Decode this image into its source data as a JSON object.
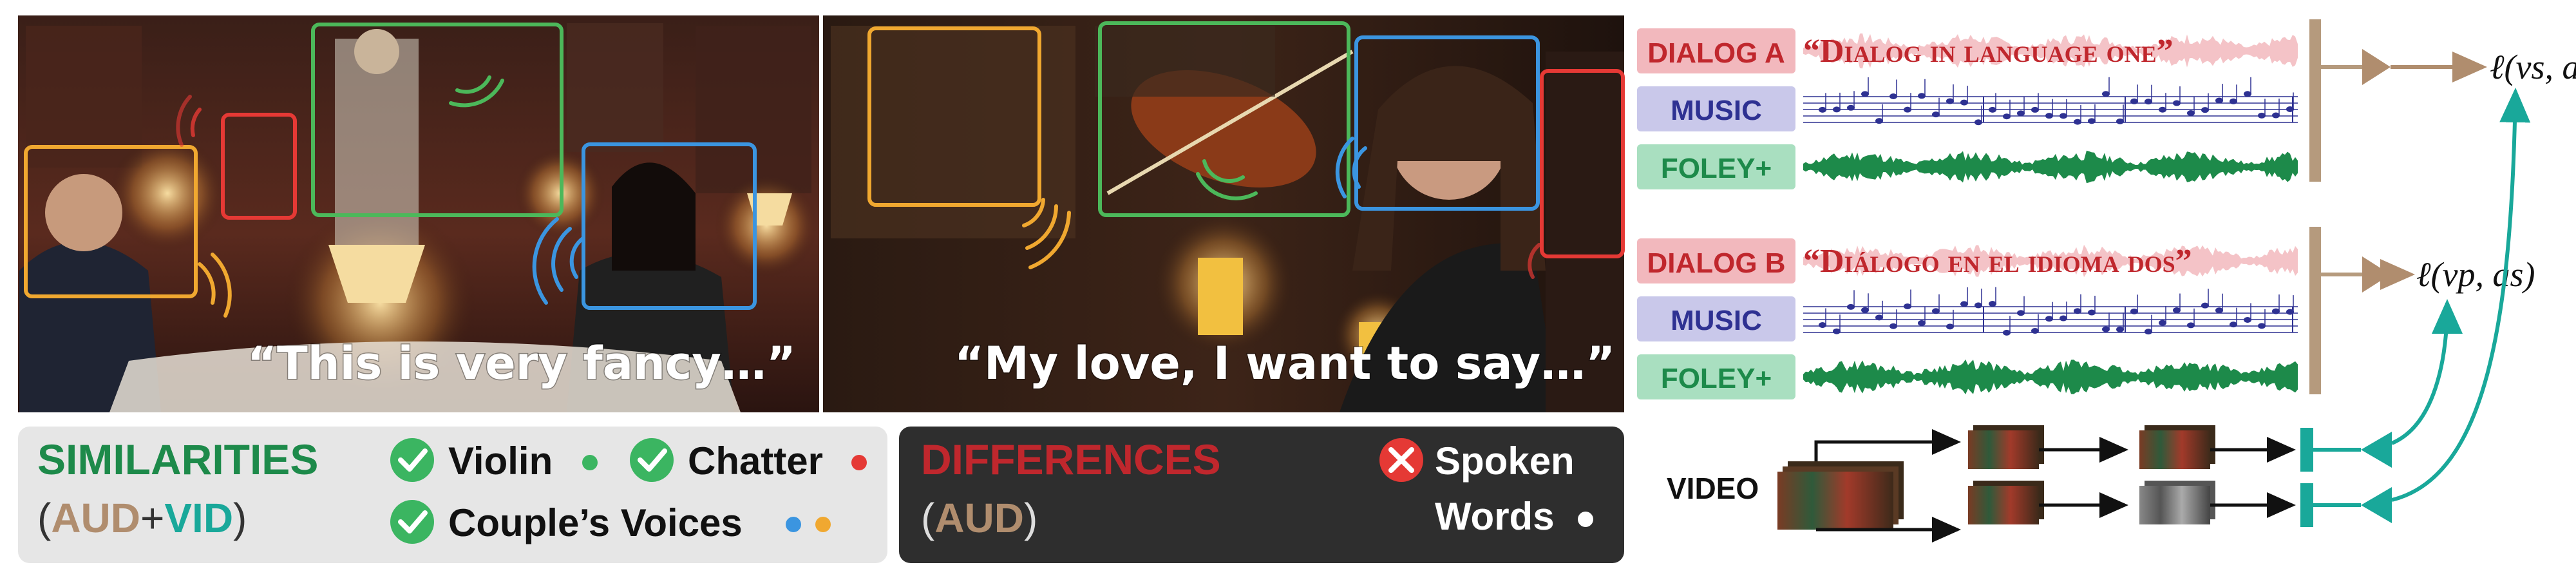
{
  "scenes": [
    {
      "caption": "“This is very fancy…”"
    },
    {
      "caption": "“My love, I want to say…”"
    }
  ],
  "similarities": {
    "title": "SIMILARITIES",
    "subtitle_open": "(",
    "aud": "AUD",
    "plus": "+",
    "vid": "VID",
    "subtitle_close": ")",
    "items": [
      "Violin",
      "Chatter",
      "Couple’s Voices"
    ]
  },
  "differences": {
    "title": "DIFFERENCES",
    "subtitle_open": "(",
    "aud": "AUD",
    "subtitle_close": ")",
    "item_line1": "Spoken",
    "item_line2": "Words"
  },
  "tracks": {
    "top": {
      "dialog_label": "DIALOG A",
      "dialog_text": "“Dialog in language one”",
      "music_label": "MUSIC",
      "foley_label": "FOLEY+",
      "loss": "ℓ(vs, ap)"
    },
    "bottom": {
      "dialog_label": "DIALOG B",
      "dialog_text": "“Diálogo en el idioma dos”",
      "music_label": "MUSIC",
      "foley_label": "FOLEY+",
      "loss": "ℓ(vp, as)"
    }
  },
  "video_label": "VIDEO",
  "colors": {
    "green": "#1d8a4a",
    "red": "#c0272d",
    "tan": "#b08d6e",
    "teal": "#19a89a",
    "dialog_bg": "#f2b8bd",
    "music_bg": "#c9c8ea",
    "foley_bg": "#a9dfc0",
    "yellow_box": "#f0a830",
    "green_box": "#4cb85a",
    "red_box": "#e53935",
    "blue_box": "#3b95e0"
  }
}
